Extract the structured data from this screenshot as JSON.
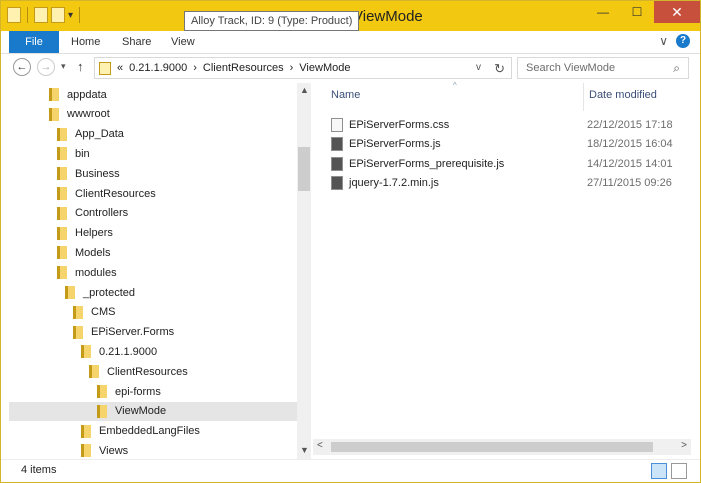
{
  "window": {
    "title": "ViewMode",
    "tooltip": "Alloy Track, ID: 9 (Type: Product)",
    "controls": {
      "minimize": "—",
      "maximize": "☐",
      "close": "✕"
    }
  },
  "ribbon": {
    "tabs": [
      "File",
      "Home",
      "Share",
      "View"
    ],
    "help": "?"
  },
  "navigation": {
    "back": "←",
    "forward": "→",
    "recent": "▾",
    "up": "↑",
    "address": {
      "overflow": "«",
      "crumbs": [
        "0.21.1.9000",
        "ClientResources",
        "ViewMode"
      ],
      "separator": "›",
      "dropdown": "v",
      "refresh": "↻"
    },
    "search": {
      "placeholder": "Search ViewMode",
      "icon": "⌕"
    }
  },
  "tree": {
    "items": [
      {
        "label": "appdata",
        "indent": 1
      },
      {
        "label": "wwwroot",
        "indent": 1
      },
      {
        "label": "App_Data",
        "indent": 2
      },
      {
        "label": "bin",
        "indent": 2
      },
      {
        "label": "Business",
        "indent": 2
      },
      {
        "label": "ClientResources",
        "indent": 2
      },
      {
        "label": "Controllers",
        "indent": 2
      },
      {
        "label": "Helpers",
        "indent": 2
      },
      {
        "label": "Models",
        "indent": 2
      },
      {
        "label": "modules",
        "indent": 2
      },
      {
        "label": "_protected",
        "indent": 3
      },
      {
        "label": "CMS",
        "indent": 4
      },
      {
        "label": "EPiServer.Forms",
        "indent": 4
      },
      {
        "label": "0.21.1.9000",
        "indent": 5
      },
      {
        "label": "ClientResources",
        "indent": 6
      },
      {
        "label": "epi-forms",
        "indent": 7
      },
      {
        "label": "ViewMode",
        "indent": 7,
        "selected": true
      },
      {
        "label": "EmbeddedLangFiles",
        "indent": 5
      },
      {
        "label": "Views",
        "indent": 5
      }
    ]
  },
  "file_list": {
    "columns": {
      "name": "Name",
      "date": "Date modified"
    },
    "files": [
      {
        "name": "EPiServerForms.css",
        "date": "22/12/2015 17:18",
        "type": "css"
      },
      {
        "name": "EPiServerForms.js",
        "date": "18/12/2015 16:04",
        "type": "js"
      },
      {
        "name": "EPiServerForms_prerequisite.js",
        "date": "14/12/2015 14:01",
        "type": "js"
      },
      {
        "name": "jquery-1.7.2.min.js",
        "date": "27/11/2015 09:26",
        "type": "js"
      }
    ]
  },
  "status": {
    "item_count": "4 items"
  }
}
